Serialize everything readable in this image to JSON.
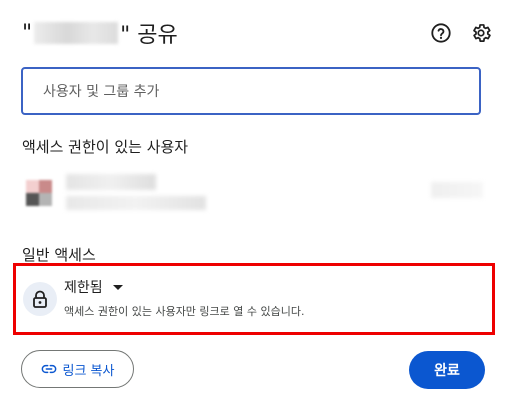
{
  "dialog": {
    "title_open_quote": "\"",
    "title_close_quote": "\" 공유",
    "help_icon": "help-circle-icon",
    "settings_icon": "gear-icon"
  },
  "add_people": {
    "placeholder": "사용자 및 그룹 추가"
  },
  "people_with_access": {
    "heading": "액세스 권한이 있는 사용자"
  },
  "general_access": {
    "heading": "일반 액세스",
    "option_label": "제한됨",
    "description": "액세스 권한이 있는 사용자만 링크로 열 수 있습니다.",
    "icon": "lock-icon"
  },
  "footer": {
    "copy_link_label": "링크 복사",
    "copy_link_icon": "link-icon",
    "done_label": "완료"
  },
  "colors": {
    "accent": "#0b57d0",
    "input_border": "#3b63c4",
    "highlight_box": "#ee0000"
  }
}
